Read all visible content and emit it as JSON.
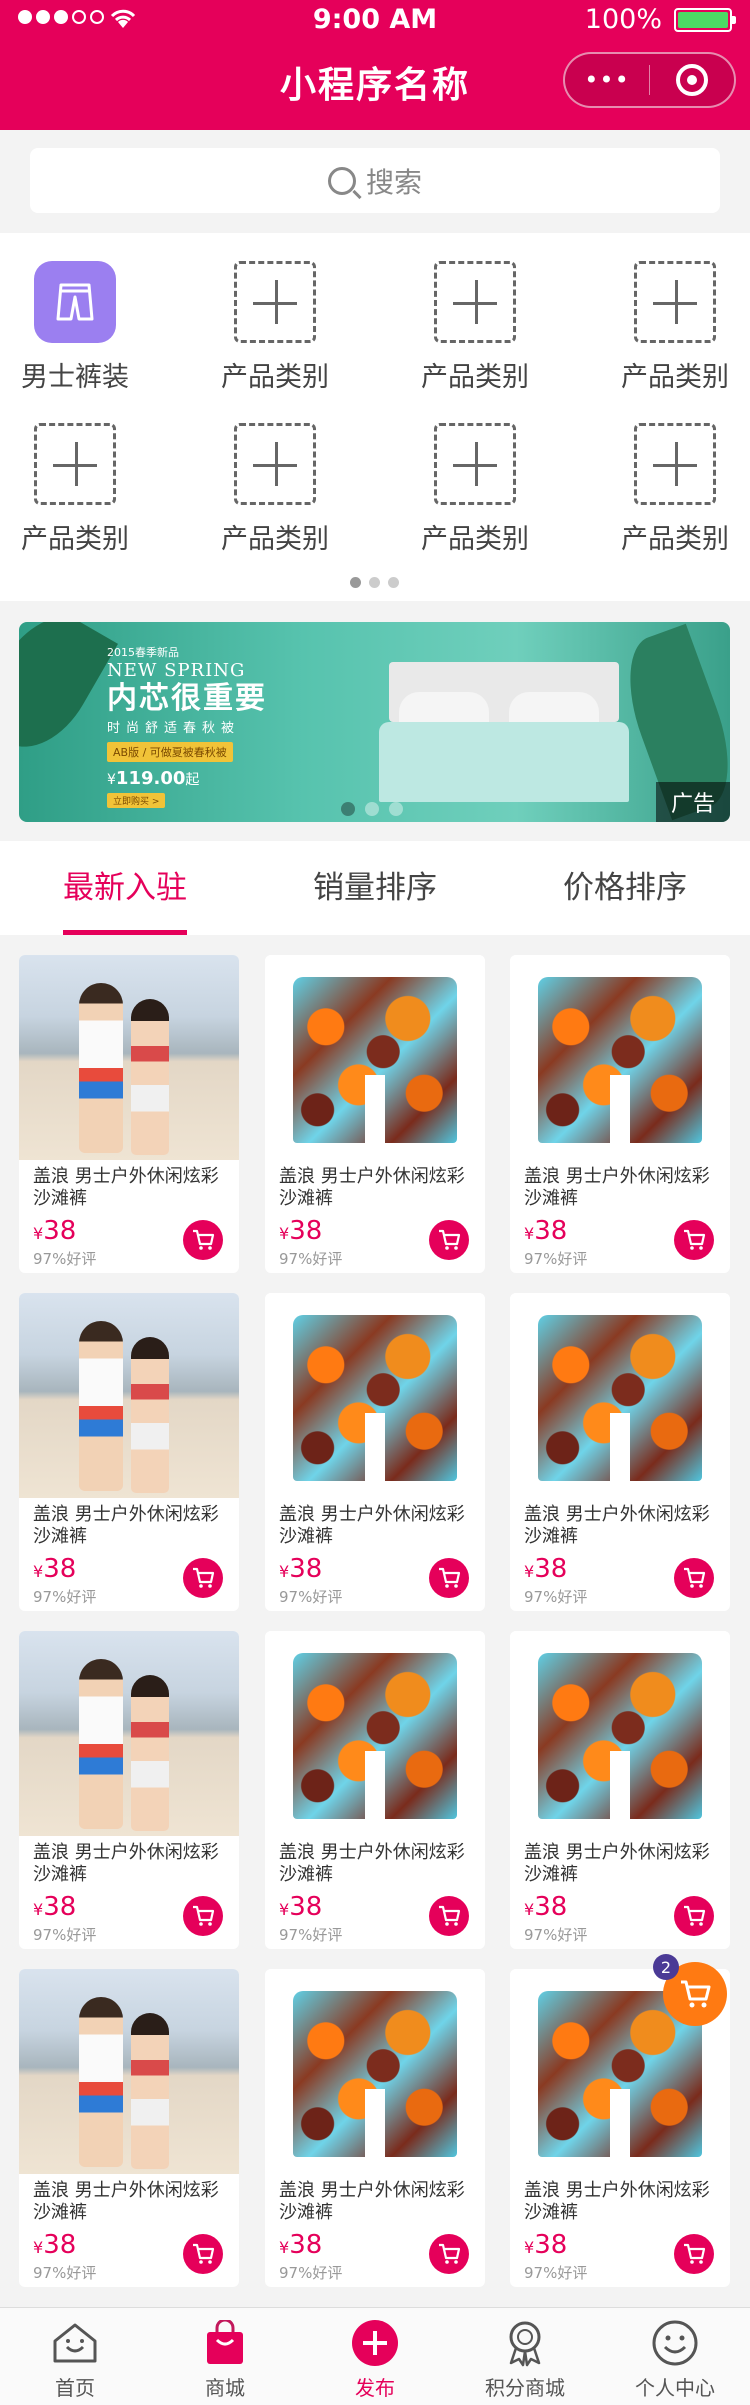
{
  "status_bar": {
    "time": "9:00 AM",
    "battery": "100%"
  },
  "header": {
    "title": "小程序名称",
    "more_label": "•••"
  },
  "search": {
    "placeholder": "搜索"
  },
  "categories": [
    {
      "label": "男士裤装",
      "icon": "pants-icon"
    },
    {
      "label": "产品类别",
      "icon": "plus-icon"
    },
    {
      "label": "产品类别",
      "icon": "plus-icon"
    },
    {
      "label": "产品类别",
      "icon": "plus-icon"
    },
    {
      "label": "产品类别",
      "icon": "plus-icon"
    },
    {
      "label": "产品类别",
      "icon": "plus-icon"
    },
    {
      "label": "产品类别",
      "icon": "plus-icon"
    },
    {
      "label": "产品类别",
      "icon": "plus-icon"
    }
  ],
  "banner": {
    "line1": "2015春季新品",
    "line2": "NEW SPRING",
    "line3": "内芯很重要",
    "line4": "时尚舒适春秋被",
    "line5": "AB版 / 可做夏被春秋被",
    "price_symbol": "¥",
    "price": "119.00",
    "price_unit": "起",
    "buy_label": "立即购买 >",
    "ad_label": "广告"
  },
  "tabs": [
    {
      "label": "最新入驻",
      "active": true
    },
    {
      "label": "销量排序",
      "active": false
    },
    {
      "label": "价格排序",
      "active": false
    }
  ],
  "products": [
    {
      "title": "盖浪 男士户外休闲炫彩沙滩裤",
      "currency": "¥",
      "price": "38",
      "rating": "97%好评",
      "image": "beach-couple"
    },
    {
      "title": "盖浪 男士户外休闲炫彩沙滩裤",
      "currency": "¥",
      "price": "38",
      "rating": "97%好评",
      "image": "shorts"
    },
    {
      "title": "盖浪 男士户外休闲炫彩沙滩裤",
      "currency": "¥",
      "price": "38",
      "rating": "97%好评",
      "image": "shorts"
    },
    {
      "title": "盖浪 男士户外休闲炫彩沙滩裤",
      "currency": "¥",
      "price": "38",
      "rating": "97%好评",
      "image": "beach-couple"
    },
    {
      "title": "盖浪 男士户外休闲炫彩沙滩裤",
      "currency": "¥",
      "price": "38",
      "rating": "97%好评",
      "image": "shorts"
    },
    {
      "title": "盖浪 男士户外休闲炫彩沙滩裤",
      "currency": "¥",
      "price": "38",
      "rating": "97%好评",
      "image": "shorts"
    },
    {
      "title": "盖浪 男士户外休闲炫彩沙滩裤",
      "currency": "¥",
      "price": "38",
      "rating": "97%好评",
      "image": "beach-couple"
    },
    {
      "title": "盖浪 男士户外休闲炫彩沙滩裤",
      "currency": "¥",
      "price": "38",
      "rating": "97%好评",
      "image": "shorts"
    },
    {
      "title": "盖浪 男士户外休闲炫彩沙滩裤",
      "currency": "¥",
      "price": "38",
      "rating": "97%好评",
      "image": "shorts"
    },
    {
      "title": "盖浪 男士户外休闲炫彩沙滩裤",
      "currency": "¥",
      "price": "38",
      "rating": "97%好评",
      "image": "beach-couple"
    },
    {
      "title": "盖浪 男士户外休闲炫彩沙滩裤",
      "currency": "¥",
      "price": "38",
      "rating": "97%好评",
      "image": "shorts"
    },
    {
      "title": "盖浪 男士户外休闲炫彩沙滩裤",
      "currency": "¥",
      "price": "38",
      "rating": "97%好评",
      "image": "shorts"
    }
  ],
  "floating_cart": {
    "count": "2"
  },
  "tabbar": [
    {
      "label": "首页",
      "icon": "home-icon",
      "active": false
    },
    {
      "label": "商城",
      "icon": "shop-bag-icon",
      "active": false
    },
    {
      "label": "发布",
      "icon": "publish-plus-icon",
      "active": true
    },
    {
      "label": "积分商城",
      "icon": "medal-icon",
      "active": false
    },
    {
      "label": "个人中心",
      "icon": "smiley-icon",
      "active": false
    }
  ],
  "colors": {
    "brand": "#e5005a",
    "accent_orange": "#ff7a12",
    "category_purple": "#9b7ff0",
    "battery_green": "#4cd964"
  }
}
